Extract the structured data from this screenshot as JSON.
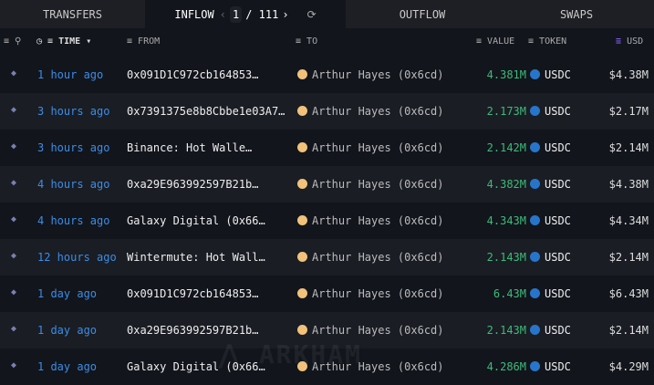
{
  "tabs": {
    "transfers": "TRANSFERS",
    "inflow": "INFLOW",
    "outflow": "OUTFLOW",
    "swaps": "SWAPS"
  },
  "pager": {
    "current": "1",
    "total": "/ 111",
    "prev": "‹",
    "next": "›",
    "refresh": "⟳"
  },
  "columns": {
    "time": "TIME",
    "from": "FROM",
    "to": "TO",
    "value": "VALUE",
    "token": "TOKEN",
    "usd": "USD"
  },
  "accent": "#3b8de6",
  "rows": [
    {
      "time": "1 hour ago",
      "from": "0x091D1C972cb164853…",
      "to": "Arthur Hayes (0x6cd)",
      "value": "4.381M",
      "token": "USDC",
      "usd": "$4.38M"
    },
    {
      "time": "3 hours ago",
      "from": "0x7391375e8b8Cbbe1e03A7…",
      "to": "Arthur Hayes (0x6cd)",
      "value": "2.173M",
      "token": "USDC",
      "usd": "$2.17M"
    },
    {
      "time": "3 hours ago",
      "from": "Binance: Hot Walle…",
      "to": "Arthur Hayes (0x6cd)",
      "value": "2.142M",
      "token": "USDC",
      "usd": "$2.14M"
    },
    {
      "time": "4 hours ago",
      "from": "0xa29E963992597B21b…",
      "to": "Arthur Hayes (0x6cd)",
      "value": "4.382M",
      "token": "USDC",
      "usd": "$4.38M"
    },
    {
      "time": "4 hours ago",
      "from": "Galaxy Digital (0x66…",
      "to": "Arthur Hayes (0x6cd)",
      "value": "4.343M",
      "token": "USDC",
      "usd": "$4.34M"
    },
    {
      "time": "12 hours ago",
      "from": "Wintermute: Hot Wall…",
      "to": "Arthur Hayes (0x6cd)",
      "value": "2.143M",
      "token": "USDC",
      "usd": "$2.14M"
    },
    {
      "time": "1 day ago",
      "from": "0x091D1C972cb164853…",
      "to": "Arthur Hayes (0x6cd)",
      "value": "6.43M",
      "token": "USDC",
      "usd": "$6.43M"
    },
    {
      "time": "1 day ago",
      "from": "0xa29E963992597B21b…",
      "to": "Arthur Hayes (0x6cd)",
      "value": "2.143M",
      "token": "USDC",
      "usd": "$2.14M"
    },
    {
      "time": "1 day ago",
      "from": "Galaxy Digital (0x66…",
      "to": "Arthur Hayes (0x6cd)",
      "value": "4.286M",
      "token": "USDC",
      "usd": "$4.29M"
    }
  ],
  "watermark": "ARKHAM"
}
